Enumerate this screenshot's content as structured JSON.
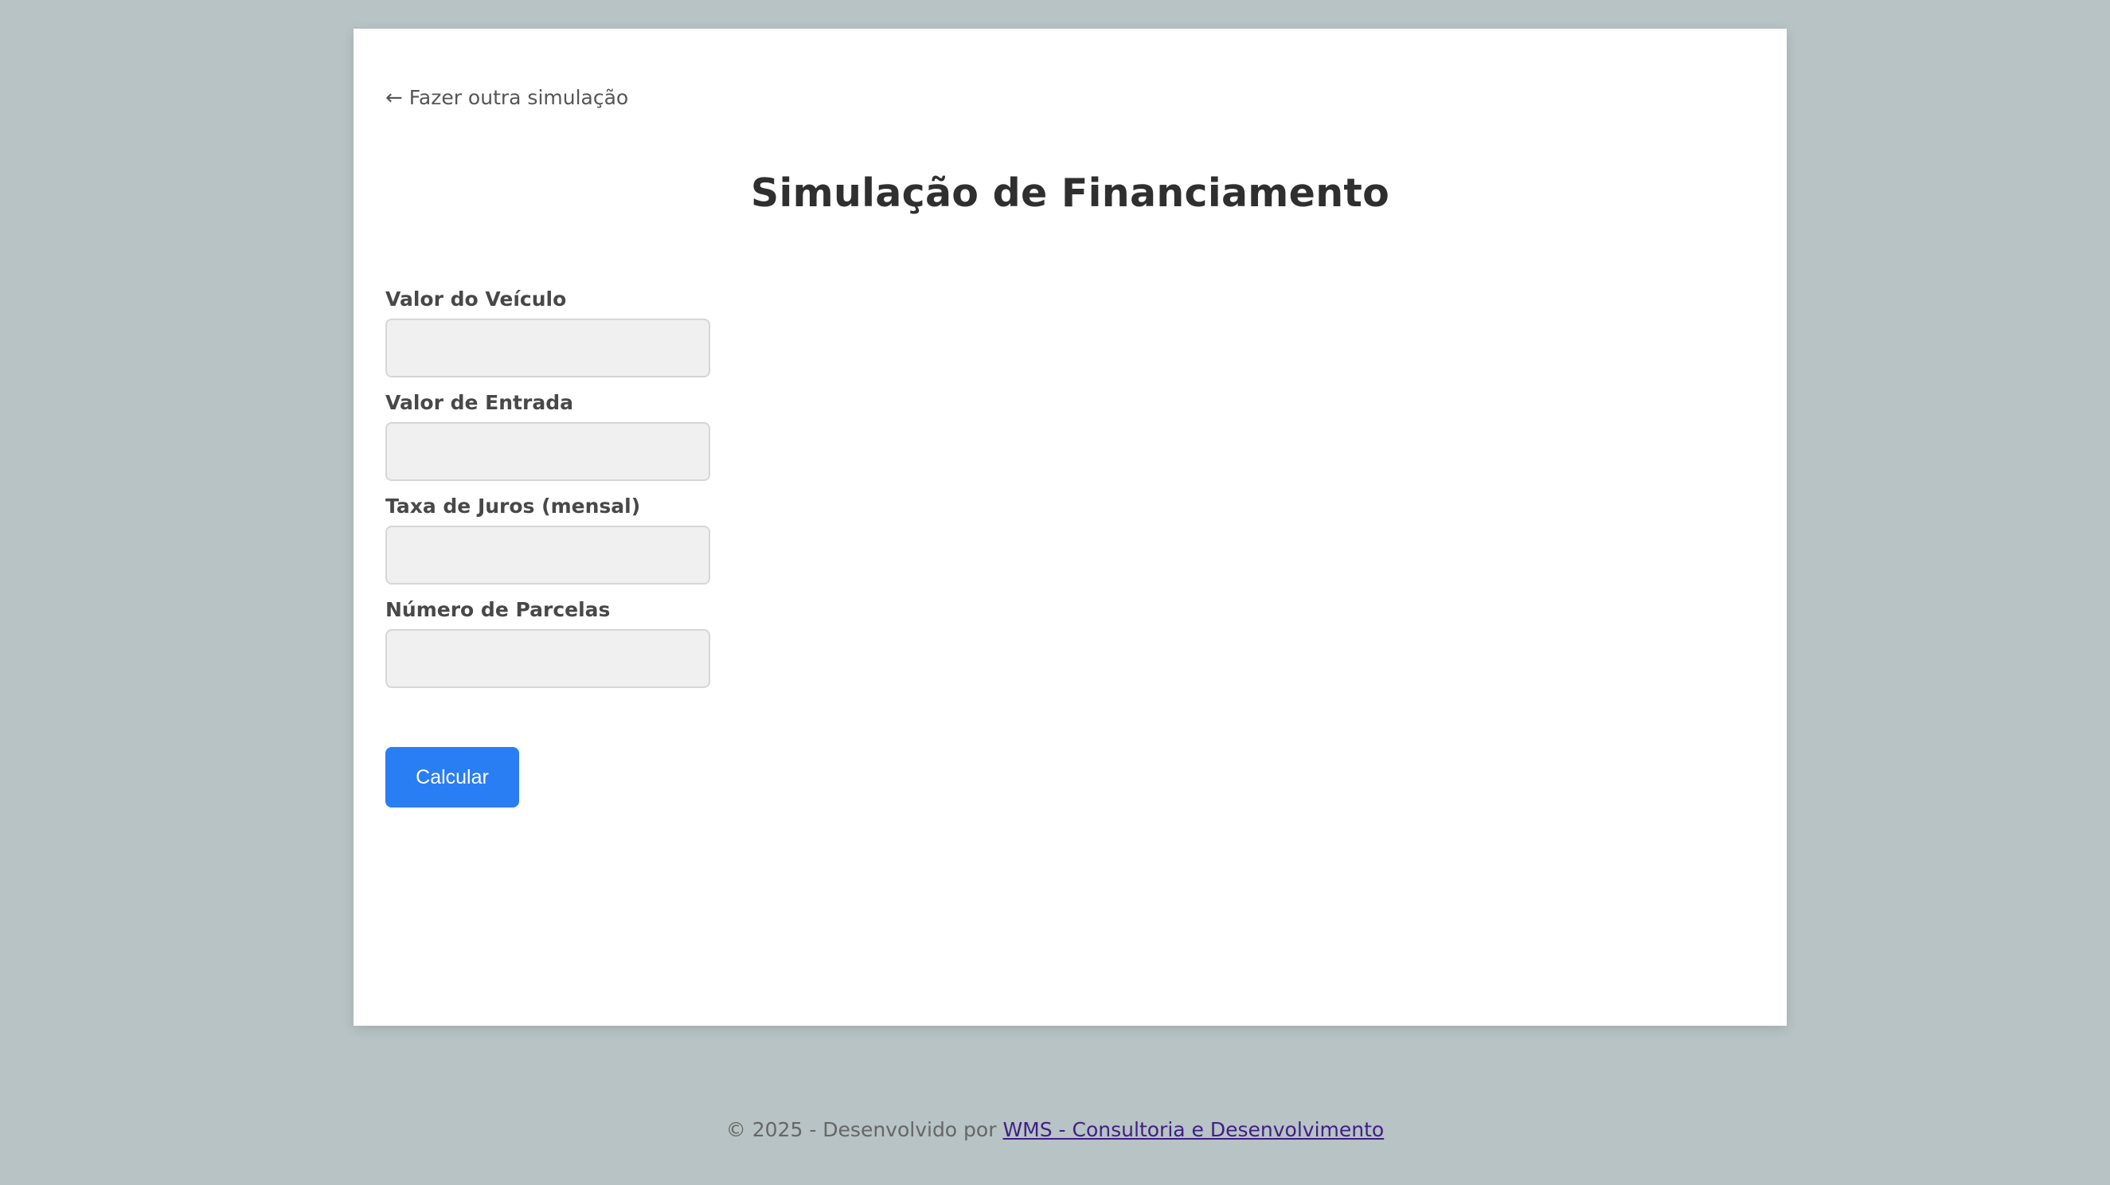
{
  "back_link": {
    "arrow": "←",
    "label": "Fazer outra simulação"
  },
  "page_title": "Simulação de Financiamento",
  "form": {
    "fields": [
      {
        "label": "Valor do Veículo",
        "value": "",
        "placeholder": ""
      },
      {
        "label": "Valor de Entrada",
        "value": "",
        "placeholder": ""
      },
      {
        "label": "Taxa de Juros (mensal)",
        "value": "",
        "placeholder": ""
      },
      {
        "label": "Número de Parcelas",
        "value": "",
        "placeholder": ""
      }
    ],
    "submit_label": "Calcular"
  },
  "footer": {
    "prefix": "© 2025 - Desenvolvido por ",
    "link_text": "WMS - Consultoria e Desenvolvimento"
  },
  "colors": {
    "background": "#b7c3c4",
    "primary_button": "#2a7ef4",
    "footer_link": "#3f1f86"
  }
}
